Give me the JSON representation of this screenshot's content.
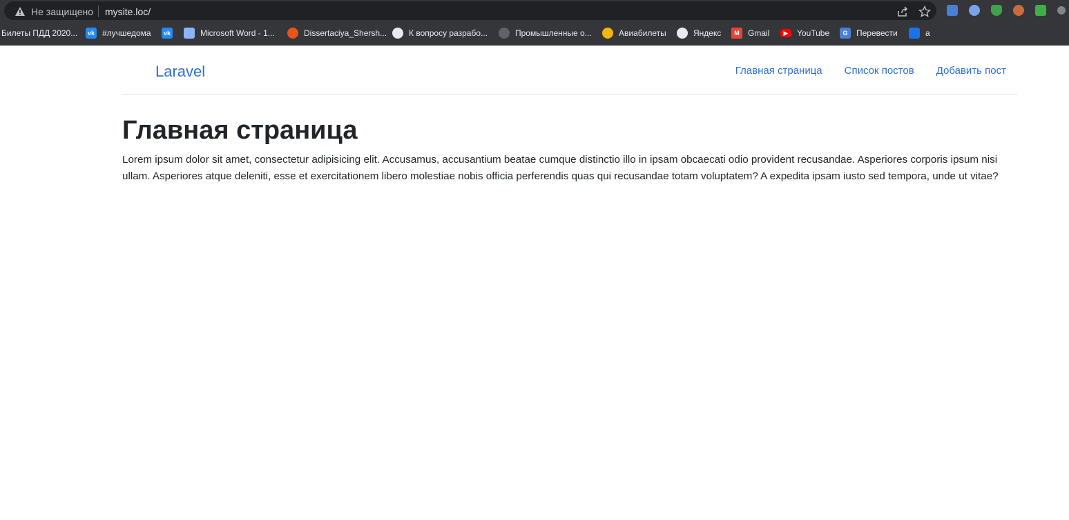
{
  "browser": {
    "security_label": "Не защищено",
    "url": "mysite.loc/",
    "bookmarks": [
      {
        "label": "Билеты ПДД 2020...",
        "icon": "folder-icon"
      },
      {
        "label": "#лучшедома",
        "icon": "vk-icon"
      },
      {
        "label": "",
        "icon": "vk-icon"
      },
      {
        "label": "Microsoft Word - 1...",
        "icon": "document-icon"
      },
      {
        "label": "Dissertaciya_Shersh...",
        "icon": "dots-icon"
      },
      {
        "label": "К вопросу разрабо...",
        "icon": "skull-icon"
      },
      {
        "label": "Промышленные о...",
        "icon": "person-icon"
      },
      {
        "label": "Авиабилеты",
        "icon": "aviasales-icon"
      },
      {
        "label": "Яндекс",
        "icon": "globe-icon"
      },
      {
        "label": "Gmail",
        "icon": "gmail-icon"
      },
      {
        "label": "YouTube",
        "icon": "youtube-icon"
      },
      {
        "label": "Перевести",
        "icon": "translate-icon"
      },
      {
        "label": "а",
        "icon": "chat-icon"
      }
    ]
  },
  "site": {
    "brand": "Laravel",
    "nav": [
      "Главная страница",
      "Список постов",
      "Добавить пост"
    ],
    "title": "Главная страница",
    "text": "Lorem ipsum dolor sit amet, consectetur adipisicing elit. Accusamus, accusantium beatae cumque distinctio illo in ipsam obcaecati odio provident recusandae. Asperiores corporis ipsum nisi ullam. Asperiores atque deleniti, esse et exercitationem libero molestiae nobis officia perferendis quas qui recusandae totam voluptatem? A expedita ipsam iusto sed tempora, unde ut vitae?"
  },
  "colors": {
    "link": "#2c6fd1",
    "text": "#212529",
    "chrome": "#35363a"
  }
}
